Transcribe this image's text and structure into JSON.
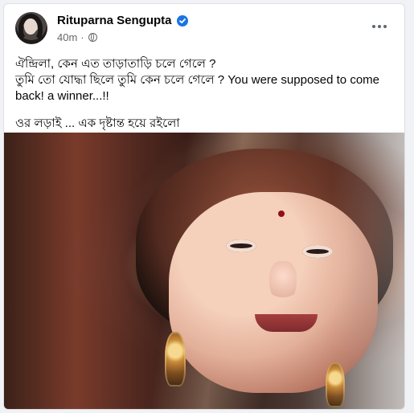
{
  "post": {
    "author_name": "Rituparna Sengupta",
    "time": "40m",
    "separator": "·",
    "content": {
      "line1": "ঐন্দ্রিলা, কেন এত তাড়াতাড়ি চলে গেলে ?",
      "line2": "তুমি তো যোদ্ধা ছিলে তুমি কেন চলে গেলে ? You were supposed to come back! a winner...!!",
      "line3": "ওর লড়াই ... এক দৃষ্টান্ত হয়ে রইলো"
    }
  },
  "icons": {
    "verified": "verified-badge-icon",
    "privacy": "globe-icon",
    "more": "more-options-icon"
  },
  "colors": {
    "page_bg": "#f0f2f5",
    "card_bg": "#ffffff",
    "text": "#050505",
    "meta": "#65676b",
    "verified": "#1b74e4"
  }
}
